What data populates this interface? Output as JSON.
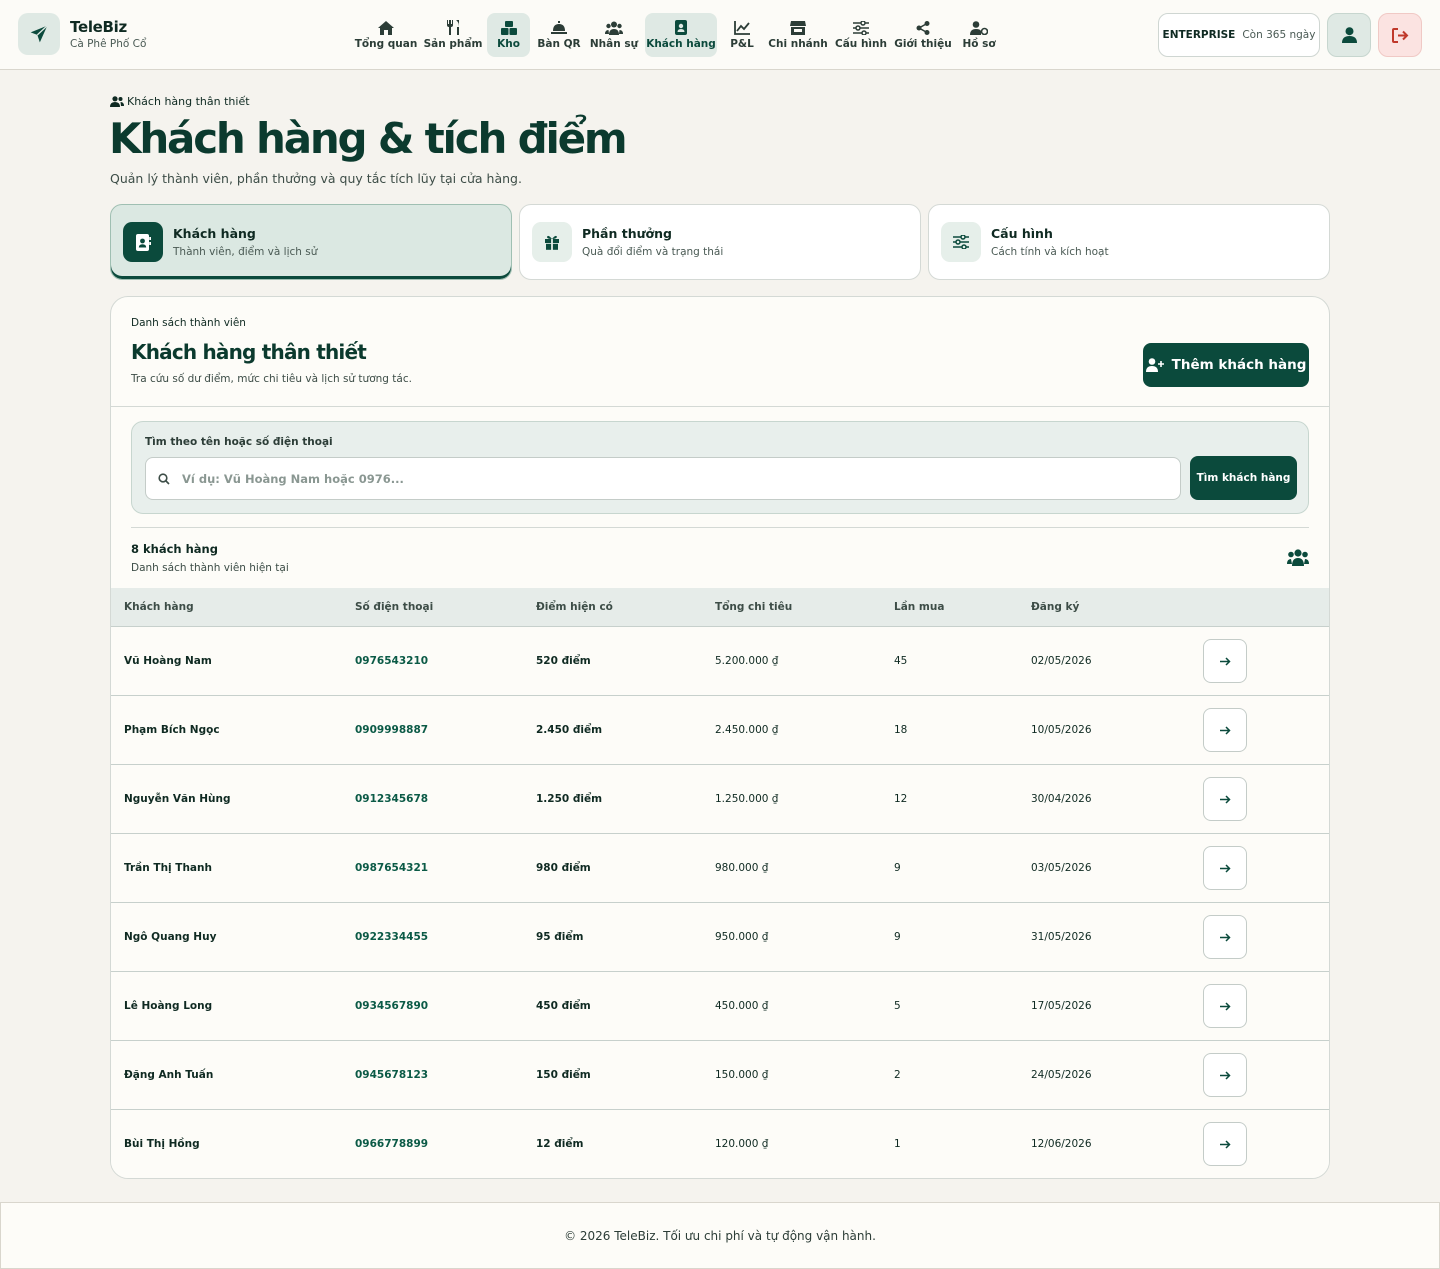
{
  "brand": {
    "name": "TeleBiz",
    "subtitle": "Cà Phê Phố Cổ"
  },
  "nav": [
    {
      "label": "Tổng quan",
      "icon": "home-icon",
      "active": false
    },
    {
      "label": "Sản phẩm",
      "icon": "utensils-icon",
      "active": false
    },
    {
      "label": "Kho",
      "icon": "boxes-icon",
      "active": true
    },
    {
      "label": "Bàn QR",
      "icon": "service-bell-icon",
      "active": false
    },
    {
      "label": "Nhân sự",
      "icon": "users-icon",
      "active": false
    },
    {
      "label": "Khách hàng",
      "icon": "address-book-icon",
      "active": true
    },
    {
      "label": "P&L",
      "icon": "line-chart-icon",
      "active": false
    },
    {
      "label": "Chi nhánh",
      "icon": "store-icon",
      "active": false
    },
    {
      "label": "Cấu hình",
      "icon": "sliders-icon",
      "active": false
    },
    {
      "label": "Giới thiệu",
      "icon": "share-icon",
      "active": false
    },
    {
      "label": "Hồ sơ",
      "icon": "user-gear-icon",
      "active": false
    }
  ],
  "plan": {
    "name": "ENTERPRISE",
    "days": "Còn 365 ngày"
  },
  "hero": {
    "eyebrow": "Khách hàng thân thiết",
    "title": "Khách hàng & tích điểm",
    "subtitle": "Quản lý thành viên, phần thưởng và quy tắc tích lũy tại cửa hàng."
  },
  "tabs": [
    {
      "title": "Khách hàng",
      "desc": "Thành viên, điểm và lịch sử",
      "icon": "address-book-icon",
      "active": true
    },
    {
      "title": "Phần thưởng",
      "desc": "Quà đổi điểm và trạng thái",
      "icon": "gift-icon",
      "active": false
    },
    {
      "title": "Cấu hình",
      "desc": "Cách tính và kích hoạt",
      "icon": "sliders-icon",
      "active": false
    }
  ],
  "card": {
    "eyebrow": "Danh sách thành viên",
    "title": "Khách hàng thân thiết",
    "desc": "Tra cứu số dư điểm, mức chi tiêu và lịch sử tương tác.",
    "add_label": "Thêm khách hàng"
  },
  "search": {
    "label": "Tìm theo tên hoặc số điện thoại",
    "placeholder": "Ví dụ: Vũ Hoàng Nam hoặc 0976...",
    "value": "",
    "button": "Tìm khách hàng"
  },
  "list": {
    "count": "8 khách hàng",
    "sub": "Danh sách thành viên hiện tại"
  },
  "table": {
    "headers": [
      "Khách hàng",
      "Số điện thoại",
      "Điểm hiện có",
      "Tổng chi tiêu",
      "Lần mua",
      "Đăng ký"
    ],
    "rows": [
      {
        "name": "Vũ Hoàng Nam",
        "phone": "0976543210",
        "points": "520 điểm",
        "spent": "5.200.000 ₫",
        "visits": "45",
        "joined": "02/05/2026"
      },
      {
        "name": "Phạm Bích Ngọc",
        "phone": "0909998887",
        "points": "2.450 điểm",
        "spent": "2.450.000 ₫",
        "visits": "18",
        "joined": "10/05/2026"
      },
      {
        "name": "Nguyễn Văn Hùng",
        "phone": "0912345678",
        "points": "1.250 điểm",
        "spent": "1.250.000 ₫",
        "visits": "12",
        "joined": "30/04/2026"
      },
      {
        "name": "Trần Thị Thanh",
        "phone": "0987654321",
        "points": "980 điểm",
        "spent": "980.000 ₫",
        "visits": "9",
        "joined": "03/05/2026"
      },
      {
        "name": "Ngô Quang Huy",
        "phone": "0922334455",
        "points": "95 điểm",
        "spent": "950.000 ₫",
        "visits": "9",
        "joined": "31/05/2026"
      },
      {
        "name": "Lê Hoàng Long",
        "phone": "0934567890",
        "points": "450 điểm",
        "spent": "450.000 ₫",
        "visits": "5",
        "joined": "17/05/2026"
      },
      {
        "name": "Đặng Anh Tuấn",
        "phone": "0945678123",
        "points": "150 điểm",
        "spent": "150.000 ₫",
        "visits": "2",
        "joined": "24/05/2026"
      },
      {
        "name": "Bùi Thị Hồng",
        "phone": "0966778899",
        "points": "12 điểm",
        "spent": "120.000 ₫",
        "visits": "1",
        "joined": "12/06/2026"
      }
    ]
  },
  "footer": "© 2026 TeleBiz. Tối ưu chi phí và tự động vận hành.",
  "colors": {
    "primary": "#0b4a3c",
    "background": "#f5f3ee",
    "accent_soft": "#dfe9e4",
    "danger": "#c0392b"
  }
}
